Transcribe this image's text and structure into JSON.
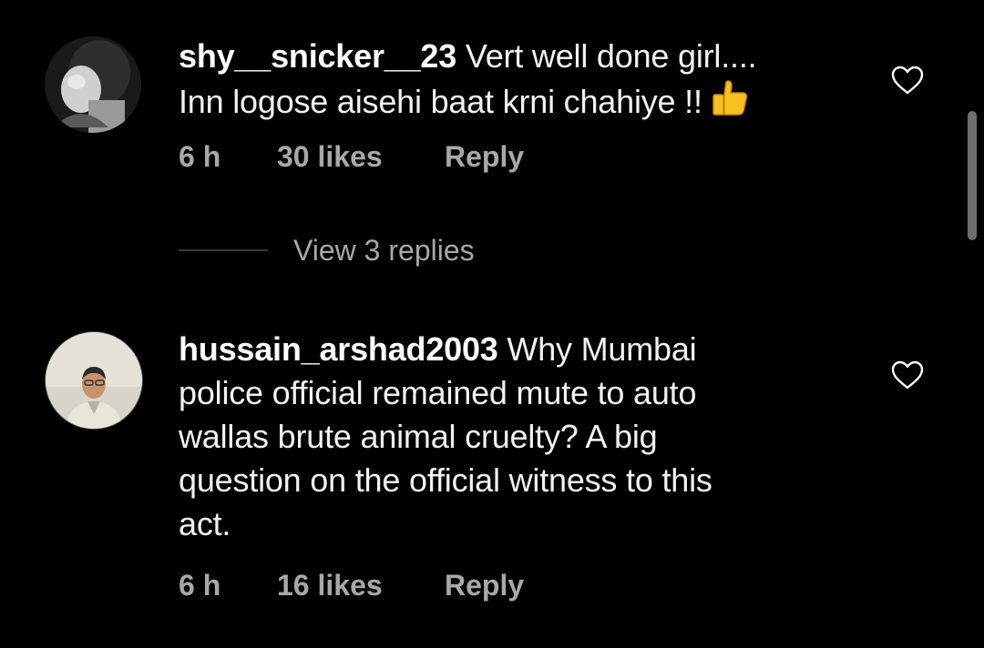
{
  "comments": [
    {
      "username": "shy__snicker__23",
      "text": "Vert well done girl....\nInn logose aisehi baat krni chahiye !!",
      "line1": "Vert well done girl....",
      "line2": "Inn logose aisehi baat krni chahiye !!",
      "emoji": "thumbs-up-icon",
      "time": "6 h",
      "likes": "30 likes",
      "reply_label": "Reply"
    },
    {
      "username": "hussain_arshad2003",
      "line1": "Why Mumbai",
      "line2": "police official remained mute to auto",
      "line3": "wallas brute animal cruelty? A big",
      "line4": "question on the official witness to this",
      "line5": "act.",
      "time": "6 h",
      "likes": "16 likes",
      "reply_label": "Reply"
    }
  ],
  "view_replies": "View 3 replies",
  "colors": {
    "background": "#000000",
    "text": "#ffffff",
    "meta": "#a8a8a8"
  }
}
